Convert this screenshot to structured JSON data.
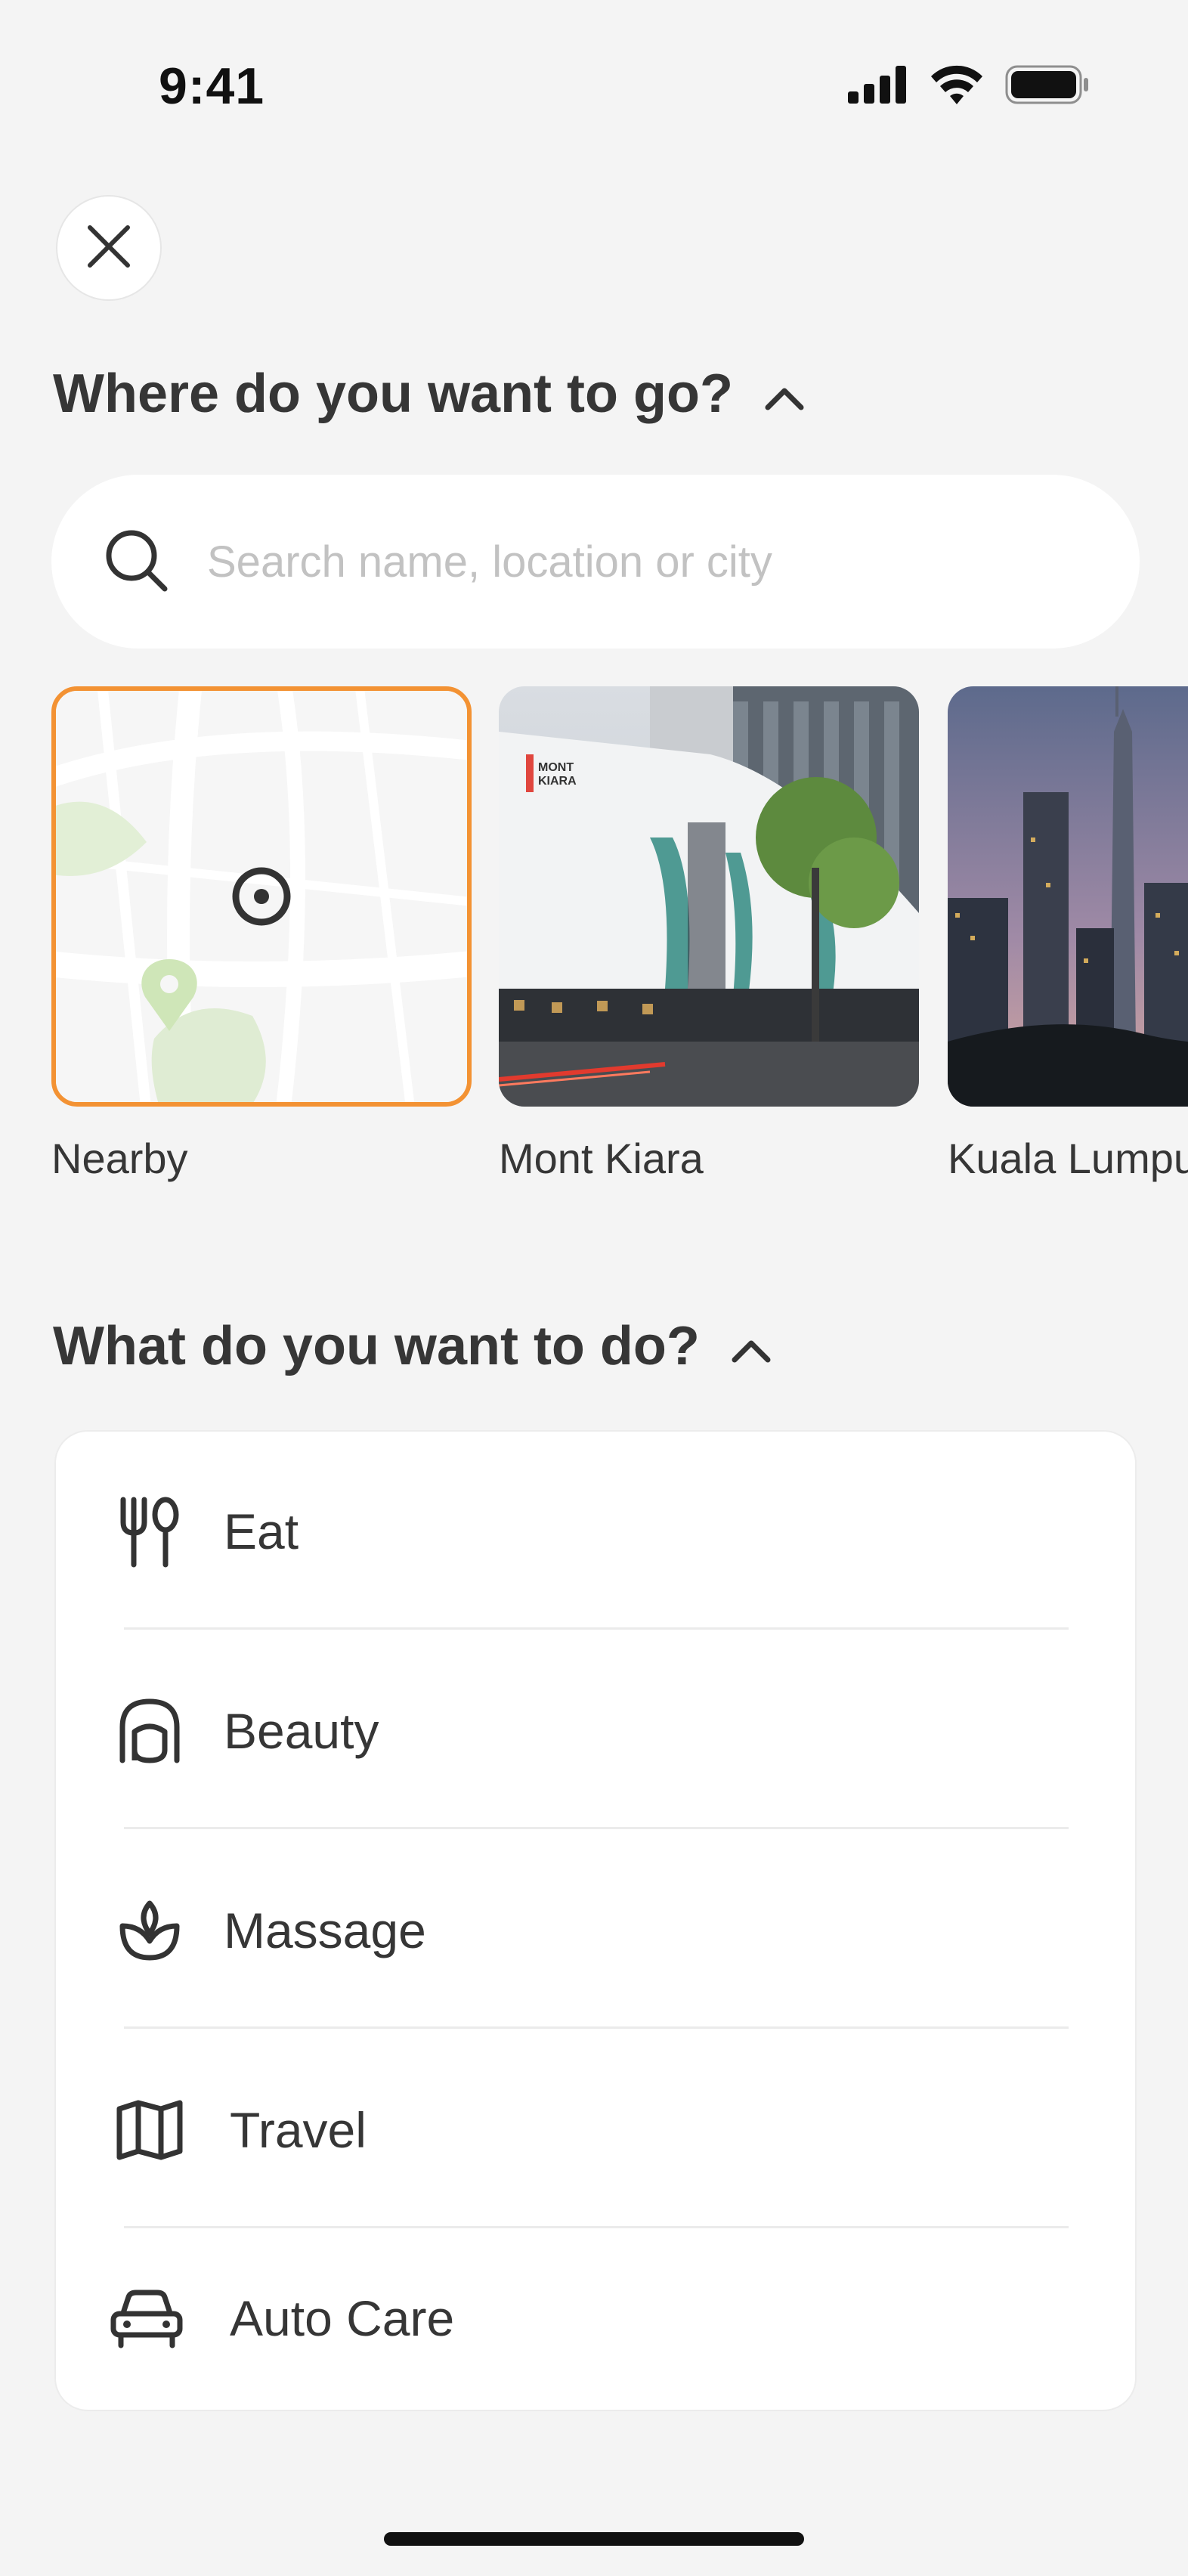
{
  "status_bar": {
    "time": "9:41"
  },
  "header": {
    "close_icon": "close-icon"
  },
  "where_section": {
    "title": "Where do you want to go?",
    "toggle_icon": "chevron-up-icon"
  },
  "search": {
    "placeholder": "Search name, location or city",
    "value": "",
    "icon": "search-icon"
  },
  "locations": [
    {
      "label": "Nearby",
      "selected": true
    },
    {
      "label": "Mont Kiara",
      "selected": false
    },
    {
      "label": "Kuala Lumpur",
      "selected": false
    }
  ],
  "what_section": {
    "title": "What do you want to do?",
    "toggle_icon": "chevron-up-icon"
  },
  "categories": [
    {
      "label": "Eat",
      "icon": "fork-knife-icon"
    },
    {
      "label": "Beauty",
      "icon": "hair-salon-icon"
    },
    {
      "label": "Massage",
      "icon": "lotus-icon"
    },
    {
      "label": "Travel",
      "icon": "map-icon"
    },
    {
      "label": "Auto Care",
      "icon": "car-icon"
    }
  ],
  "colors": {
    "accent": "#f39233",
    "background": "#f4f4f4",
    "text": "#363636",
    "placeholder": "#c2c2c2"
  }
}
